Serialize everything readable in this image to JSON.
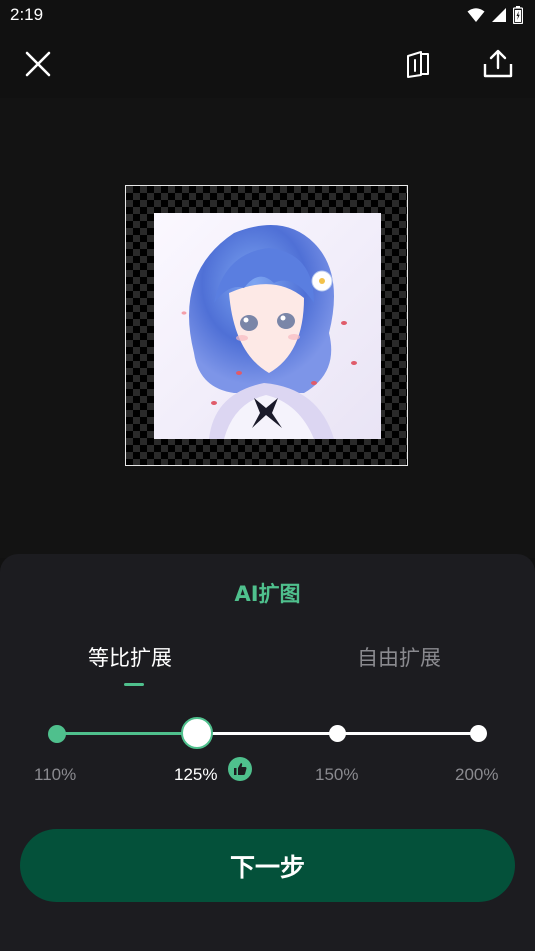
{
  "status_bar": {
    "time": "2:19"
  },
  "toolbar": {
    "close_icon": "close-icon",
    "compare_icon": "compare-icon",
    "share_icon": "share-icon"
  },
  "panel": {
    "title": "AI扩图",
    "tabs": [
      {
        "label": "等比扩展",
        "active": true
      },
      {
        "label": "自由扩展",
        "active": false
      }
    ],
    "scale_options": [
      "110%",
      "125%",
      "150%",
      "200%"
    ],
    "selected_scale": "125%",
    "recommended_icon": "thumbs-up-icon",
    "next_label": "下一步"
  },
  "colors": {
    "accent": "#4fc08d",
    "button": "#04513a",
    "panel": "#1c1c20"
  }
}
